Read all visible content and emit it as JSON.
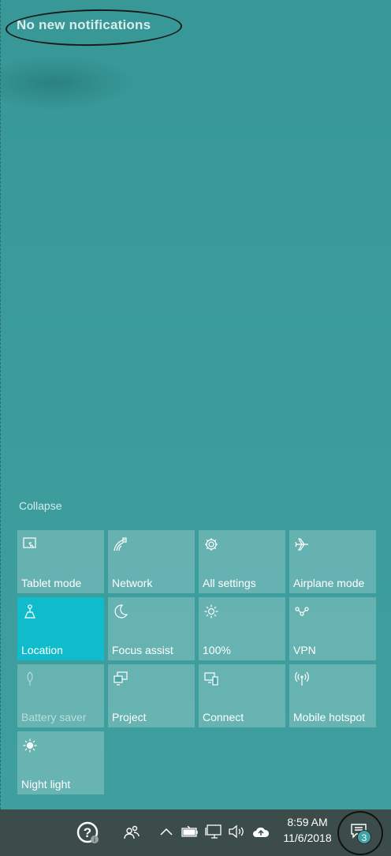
{
  "action_center": {
    "header_text": "No new notifications",
    "collapse_label": "Collapse",
    "tiles": [
      {
        "label": "Tablet mode",
        "icon": "tablet-mode-icon",
        "active": false,
        "disabled": false
      },
      {
        "label": "Network",
        "icon": "network-icon",
        "active": false,
        "disabled": false
      },
      {
        "label": "All settings",
        "icon": "gear-icon",
        "active": false,
        "disabled": false
      },
      {
        "label": "Airplane mode",
        "icon": "airplane-icon",
        "active": false,
        "disabled": false
      },
      {
        "label": "Location",
        "icon": "location-icon",
        "active": true,
        "disabled": false
      },
      {
        "label": "Focus assist",
        "icon": "moon-icon",
        "active": false,
        "disabled": false
      },
      {
        "label": "100%",
        "icon": "brightness-icon",
        "active": false,
        "disabled": false
      },
      {
        "label": "VPN",
        "icon": "vpn-icon",
        "active": false,
        "disabled": false
      },
      {
        "label": "Battery saver",
        "icon": "battery-saver-icon",
        "active": false,
        "disabled": true
      },
      {
        "label": "Project",
        "icon": "project-icon",
        "active": false,
        "disabled": false
      },
      {
        "label": "Connect",
        "icon": "connect-icon",
        "active": false,
        "disabled": false
      },
      {
        "label": "Mobile hotspot",
        "icon": "hotspot-icon",
        "active": false,
        "disabled": false
      },
      {
        "label": "Night light",
        "icon": "night-light-icon",
        "active": false,
        "disabled": false
      }
    ]
  },
  "taskbar": {
    "time": "8:59 AM",
    "date": "11/6/2018",
    "notification_count": "3",
    "tray_icons": [
      "help-icon",
      "people-icon",
      "chevron-up-icon",
      "battery-icon",
      "network-monitor-icon",
      "volume-icon",
      "cloud-upload-icon",
      "action-center-icon"
    ]
  },
  "colors": {
    "panel_bg": "#3a9a99",
    "tile_bg": "rgba(255,255,255,0.22)",
    "tile_active": "#10bccb",
    "taskbar_bg": "#3c4c4b"
  }
}
